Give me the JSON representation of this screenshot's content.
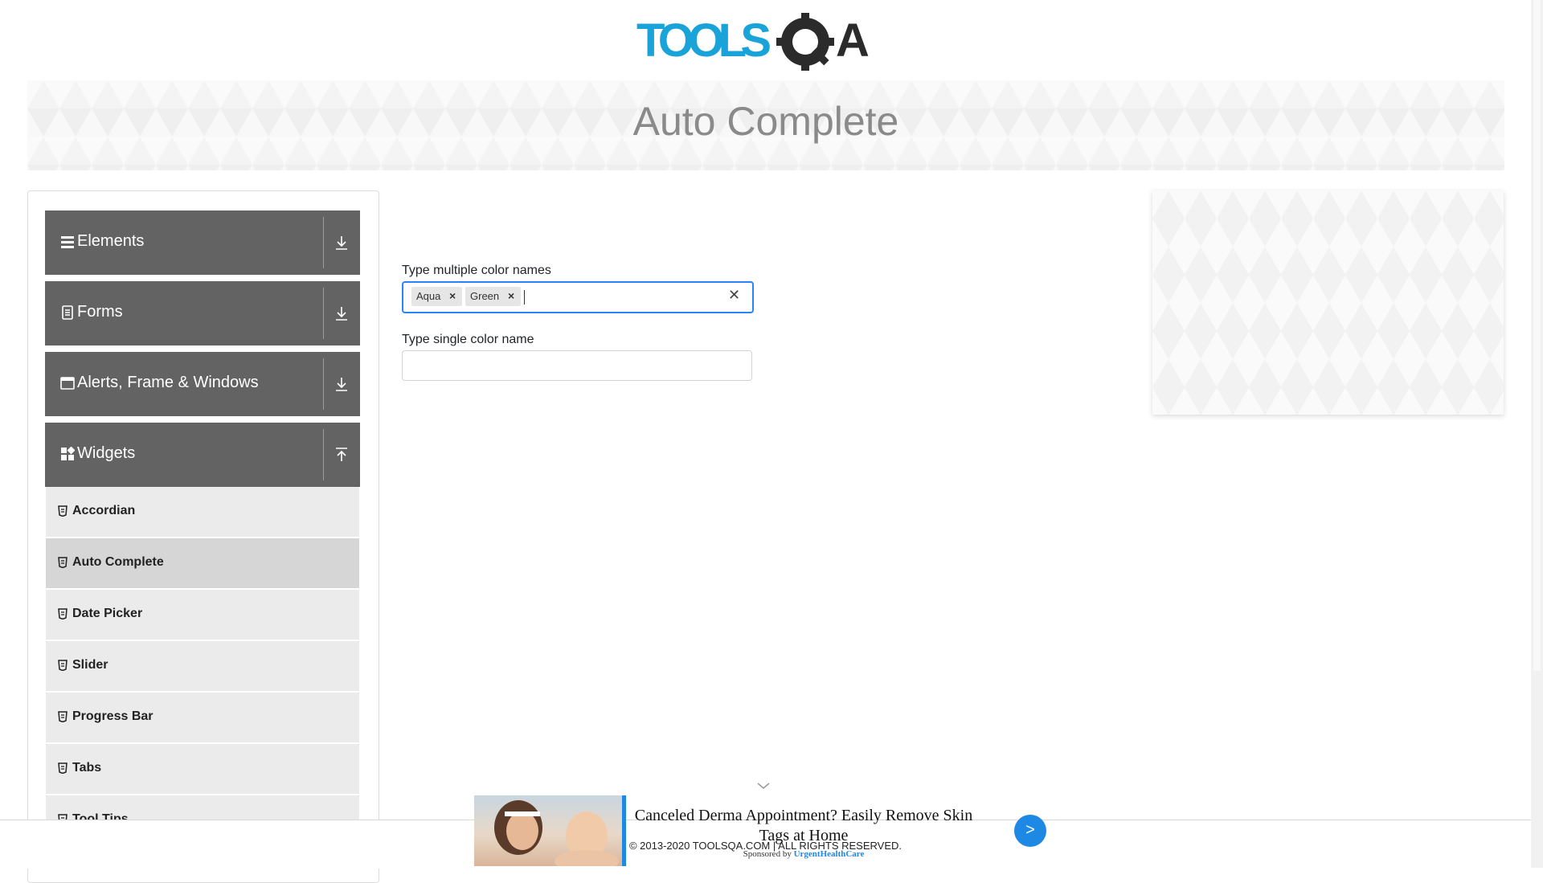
{
  "header": {
    "logo_text_left": "TOOLS",
    "logo_text_right": "A",
    "brand_colors": {
      "tools": "#1aa3d9",
      "qa": "#2b2b2b"
    }
  },
  "banner": {
    "title": "Auto Complete"
  },
  "sidebar": {
    "groups": [
      {
        "label": "Elements",
        "icon": "list-icon",
        "expanded": false
      },
      {
        "label": "Forms",
        "icon": "document-icon",
        "expanded": false
      },
      {
        "label": "Alerts, Frame & Windows",
        "icon": "window-icon",
        "expanded": false
      },
      {
        "label": "Widgets",
        "icon": "widgets-icon",
        "expanded": true
      }
    ],
    "widget_items": [
      {
        "label": "Accordian"
      },
      {
        "label": "Auto Complete",
        "active": true
      },
      {
        "label": "Date Picker"
      },
      {
        "label": "Slider"
      },
      {
        "label": "Progress Bar"
      },
      {
        "label": "Tabs"
      },
      {
        "label": "Tool Tips"
      }
    ]
  },
  "form": {
    "multi_label": "Type multiple color names",
    "multi_values": [
      "Aqua",
      "Green"
    ],
    "single_label": "Type single color name",
    "single_value": "",
    "focus_color": "#2684ff"
  },
  "footer": {
    "copyright": "© 2013-2020 TOOLSQA.COM | ALL RIGHTS RESERVED."
  },
  "ad": {
    "headline": "Canceled Derma Appointment? Easily Remove Skin Tags at Home",
    "sponsored_by": "Sponsored by",
    "sponsor": "UrgentHealthCare",
    "button_label": ">",
    "accent_color": "#1e88e5"
  }
}
